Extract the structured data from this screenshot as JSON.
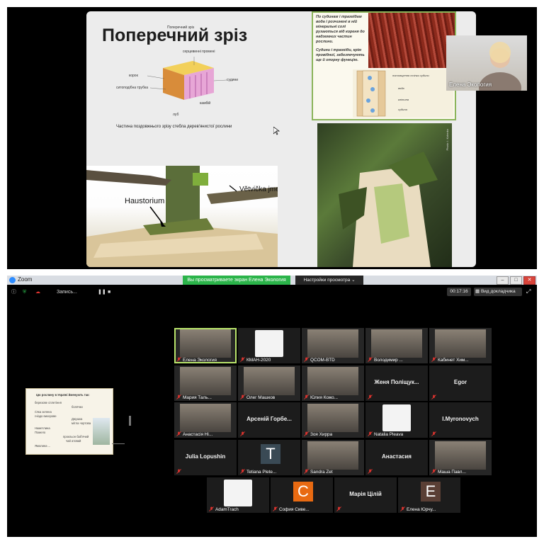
{
  "slide": {
    "title": "Поперечний зріз",
    "diagram_labels": {
      "top": "Поперечний зріз",
      "core": "серцевинні промені",
      "bark": "корок",
      "sieve": "ситоподібна трубка",
      "vessels": "судини",
      "cambium": "камбій",
      "bast": "луб"
    },
    "diagram_caption": "Частина поздовжнього зрізу стебла дерев'янистої рослини",
    "photo_labels": {
      "haustorium": "Haustorium",
      "branch": "Větvička jmelí"
    },
    "vessel_text": [
      "По судинам і трахеїдам вода і розчинені в ній мінеральні солі рухаються від кореня до надземних частин рослини.",
      "Судини і трахеїди, крім провідної, забезпечують ще й опорну функцію."
    ],
    "vessel_diagram_labels": {
      "wall": "потовщення стінки судини",
      "water": "вода",
      "cell": "клітина",
      "vessel": "судина"
    },
    "trunk_credit": "Photo: I. Kolenko"
  },
  "presenter": {
    "name": "Елена Экология"
  },
  "zoom": {
    "app_title": "Zoom",
    "share_banner": "Вы просматриваете экран Елена Экология",
    "view_options": "Настройки просмотра ⌄",
    "record_label": "Запись...",
    "timer": "00:17:16",
    "speaker_view": "Вид докладчика",
    "mini_share": {
      "caption": "Цю рослину в Україні йменують так:",
      "words": [
        "березове сплетіння",
        "болячки",
        "гілка зелена",
        "гніздо вихорове",
        "Джушка",
        "мітла чортова",
        "Наметлина",
        "Помело",
        "прокльон баб'ячий",
        "чай атовий",
        "Ямолина ..."
      ]
    },
    "participants": [
      {
        "name": "Елена Экология",
        "label": "",
        "type": "video",
        "active": true
      },
      {
        "name": "КМАН-2020",
        "label": "",
        "type": "logo"
      },
      {
        "name": "QCOM-BTD",
        "label": "",
        "type": "video"
      },
      {
        "name": "Володимир ...",
        "label": "",
        "type": "video"
      },
      {
        "name": "Кабинет Хим...",
        "label": "",
        "type": "video"
      },
      {
        "name": "Мария Таль...",
        "label": "",
        "type": "video"
      },
      {
        "name": "Олег Машков",
        "label": "",
        "type": "video"
      },
      {
        "name": "Юлия Кожо...",
        "label": "",
        "type": "video"
      },
      {
        "name": "",
        "label": "Женя Поліщук...",
        "type": "name"
      },
      {
        "name": "",
        "label": "Egor",
        "type": "name"
      },
      {
        "name": "Анастасія Ні...",
        "label": "",
        "type": "video"
      },
      {
        "name": "",
        "label": "Арсеній Горбе...",
        "type": "name"
      },
      {
        "name": "Зоя Хирра",
        "label": "",
        "type": "video"
      },
      {
        "name": "Natalia Pleava",
        "label": "",
        "type": "logo"
      },
      {
        "name": "",
        "label": "I.Myronovych",
        "type": "name"
      },
      {
        "name": "",
        "label": "Julia Lopushin",
        "type": "name"
      },
      {
        "name": "Tetiana Plete...",
        "label": "T",
        "type": "letter",
        "color": "#3a4a55"
      },
      {
        "name": "Sandra Zet",
        "label": "",
        "type": "video"
      },
      {
        "name": "",
        "label": "Анастасия",
        "type": "name"
      },
      {
        "name": "Маша Павл...",
        "label": "",
        "type": "video"
      },
      {
        "name": "AdamTrach",
        "label": "",
        "type": "logo"
      },
      {
        "name": "София Сиве...",
        "label": "С",
        "type": "letter",
        "color": "#e86a12"
      },
      {
        "name": "",
        "label": "Марія Цілій",
        "type": "name"
      },
      {
        "name": "Елена Юрчу...",
        "label": "Е",
        "type": "letter",
        "color": "#5a3f35"
      }
    ]
  },
  "colors": {
    "share_banner": "#2bb44a",
    "active_speaker": "#b8e36a",
    "muted_mic": "#e0342f",
    "zoom_blue": "#2d8cff"
  }
}
